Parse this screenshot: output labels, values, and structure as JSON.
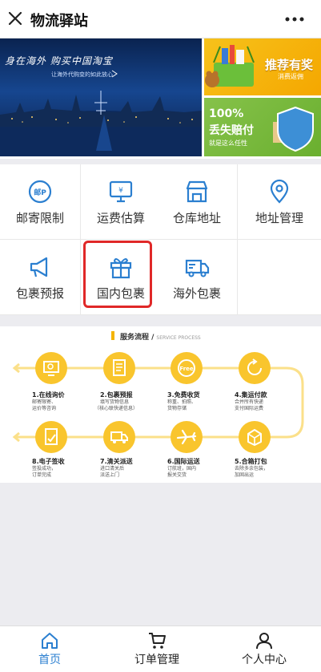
{
  "header": {
    "title": "物流驿站"
  },
  "banner": {
    "slogan": "身在海外 购买中国淘宝",
    "sub": "让海外代购变的如此放心",
    "promo1": {
      "title": "推荐有奖",
      "sub": "消费返佣"
    },
    "promo2": {
      "line1": "100%",
      "line2": "丢失赔付",
      "sub": "就是这么任性"
    }
  },
  "menu": [
    {
      "label": "邮寄限制",
      "icon": "postal-limit-icon"
    },
    {
      "label": "运费估算",
      "icon": "freight-estimate-icon"
    },
    {
      "label": "仓库地址",
      "icon": "warehouse-icon"
    },
    {
      "label": "地址管理",
      "icon": "location-pin-icon"
    },
    {
      "label": "包裹预报",
      "icon": "megaphone-icon"
    },
    {
      "label": "国内包裹",
      "icon": "gift-icon"
    },
    {
      "label": "海外包裹",
      "icon": "truck-icon"
    }
  ],
  "process": {
    "heading": "服务流程 /",
    "heading_en": "SERVICE PROCESS",
    "steps": [
      {
        "title": "1.在线询价",
        "desc1": "邮寄限寄、",
        "desc2": "运价等咨询",
        "icon": "monitor-icon"
      },
      {
        "title": "2.包裹预报",
        "desc1": "填写货物信息",
        "desc2": "（核心联快递信息）",
        "icon": "document-icon"
      },
      {
        "title": "3.免费收货",
        "desc1": "称重、拍照、",
        "desc2": "货物存储",
        "icon": "free-icon"
      },
      {
        "title": "4.集运付款",
        "desc1": "合并所有快递",
        "desc2": "支付国际运费",
        "icon": "refresh-icon"
      },
      {
        "title": "8.电子签收",
        "desc1": "签投成功，",
        "desc2": "订单完成",
        "icon": "sign-icon"
      },
      {
        "title": "7.清关派送",
        "desc1": "进口清关后",
        "desc2": "派送上门",
        "icon": "truck-icon"
      },
      {
        "title": "6.国际运送",
        "desc1": "订航班，国内",
        "desc2": "报关交货",
        "icon": "plane-icon"
      },
      {
        "title": "5.合箱打包",
        "desc1": "去除多余包装，",
        "desc2": "加固出运",
        "icon": "box-icon"
      }
    ]
  },
  "tabbar": [
    {
      "label": "首页",
      "icon": "home-icon",
      "active": true
    },
    {
      "label": "订单管理",
      "icon": "cart-icon",
      "active": false
    },
    {
      "label": "个人中心",
      "icon": "user-icon",
      "active": false
    }
  ],
  "colors": {
    "accent": "#2b7fd0",
    "highlight": "#e02828",
    "process": "#f9c52d"
  }
}
